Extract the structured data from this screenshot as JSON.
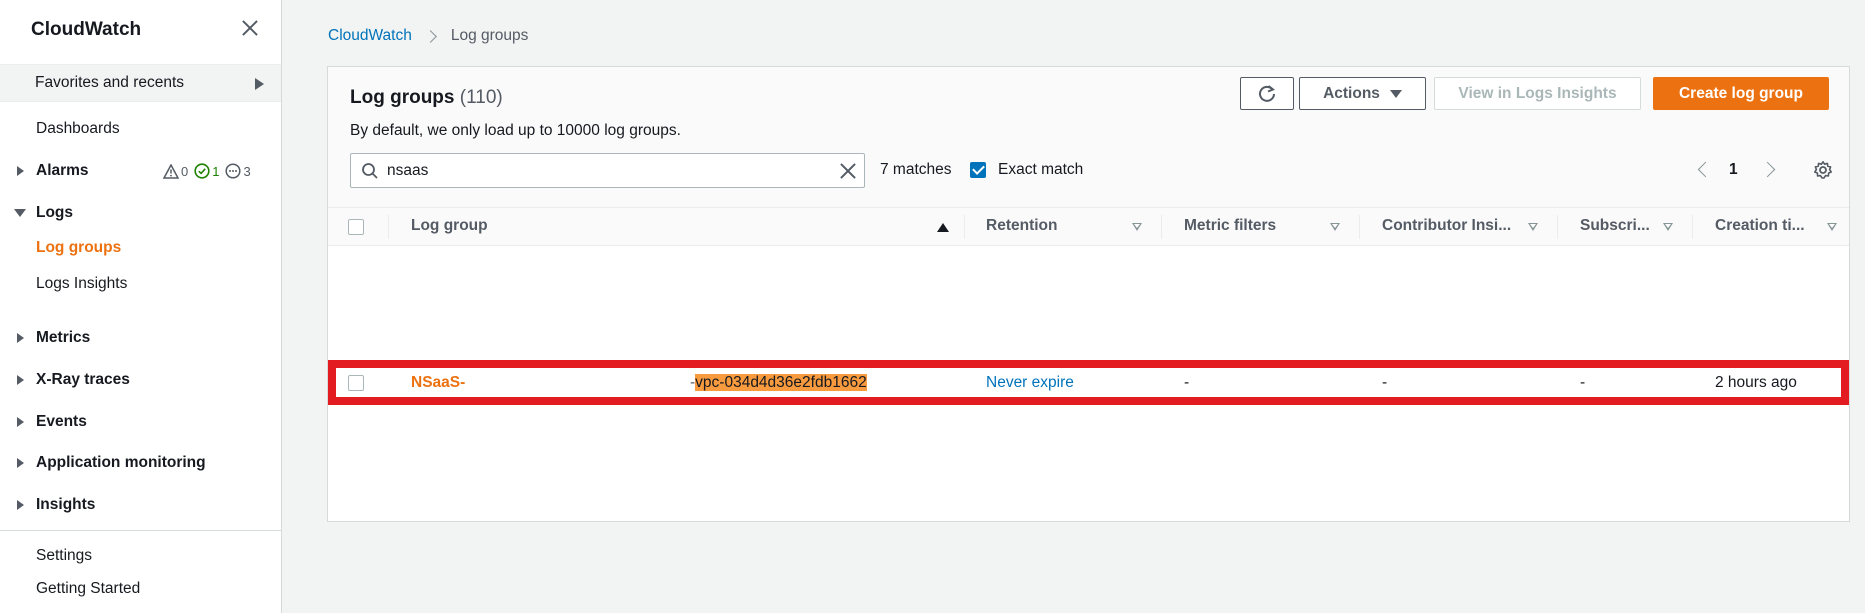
{
  "sidebar": {
    "title": "CloudWatch",
    "favorites_label": "Favorites and recents",
    "dashboards": "Dashboards",
    "alarms": "Alarms",
    "alarm_counts": {
      "alarm": "0",
      "ok": "1",
      "insufficient": "3"
    },
    "logs": "Logs",
    "log_groups": "Log groups",
    "logs_insights": "Logs Insights",
    "metrics": "Metrics",
    "xray": "X-Ray traces",
    "events": "Events",
    "app_monitoring": "Application monitoring",
    "insights": "Insights",
    "settings": "Settings",
    "getting_started": "Getting Started"
  },
  "breadcrumb": {
    "root": "CloudWatch",
    "current": "Log groups"
  },
  "panel": {
    "title": "Log groups",
    "count": "(110)",
    "description": "By default, we only load up to 10000 log groups.",
    "actions_label": "Actions",
    "view_insights_label": "View in Logs Insights",
    "create_label": "Create log group",
    "search_value": "nsaas",
    "matches": "7 matches",
    "exact_match_label": "Exact match",
    "page": "1"
  },
  "table": {
    "columns": [
      "Log group",
      "Retention",
      "Metric filters",
      "Contributor Insi...",
      "Subscri...",
      "Creation ti..."
    ],
    "rows": [
      {
        "log_group_prefix": "NSaaS-",
        "log_group_dash": "-",
        "log_group_highlight": "vpc-034d4d36e2fdb1662",
        "retention": "Never expire",
        "metric_filters": "-",
        "contributor_insights": "-",
        "subscriptions": "-",
        "creation_time": "2 hours ago"
      }
    ]
  },
  "colors": {
    "accent": "#ec7211",
    "link": "#0073bb",
    "highlight_border": "#e21c21",
    "match_highlight": "#f89a3e"
  }
}
